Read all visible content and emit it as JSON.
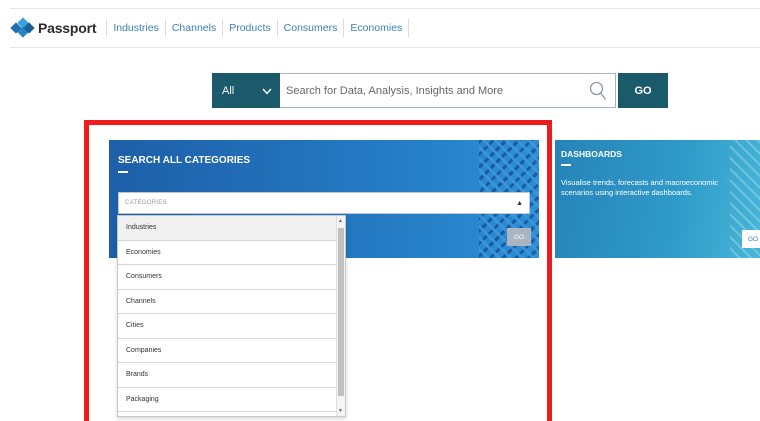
{
  "header": {
    "logo_text": "Passport",
    "nav": [
      "Industries",
      "Channels",
      "Products",
      "Consumers",
      "Economies"
    ]
  },
  "search": {
    "scope_value": "All",
    "placeholder": "Search for Data, Analysis, Insights and More",
    "go_label": "GO"
  },
  "categories_panel": {
    "title": "SEARCH ALL CATEGORIES",
    "select_placeholder": "CATEGORIES",
    "go_label": "GO",
    "options": [
      "Industries",
      "Economies",
      "Consumers",
      "Channels",
      "Cities",
      "Companies",
      "Brands",
      "Packaging"
    ],
    "highlighted_option": "Industries"
  },
  "dashboards_panel": {
    "title": "DASHBOARDS",
    "description": "Visualise trends, forecasts and macroeconomic scenarios using interactive dashboards.",
    "go_label": "GO"
  },
  "colors": {
    "highlight_frame": "#ee1c1c",
    "brand_dark": "#1a5a6b",
    "nav_link": "#3c7fb8",
    "categories_panel": "#2479c2",
    "dashboards_panel": "#2f9bc9"
  }
}
